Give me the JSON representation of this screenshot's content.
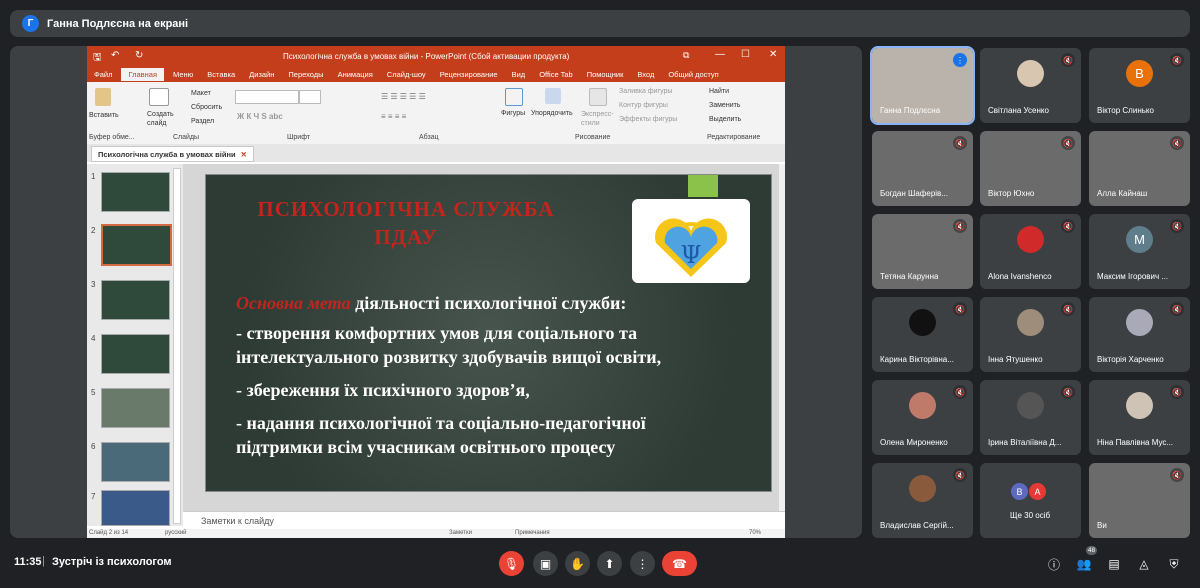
{
  "top_bar": {
    "avatar_letter": "Г",
    "title": "Ганна Подлєсна на екрані"
  },
  "powerpoint": {
    "window_title": "Психологічна служба в умовах війни - PowerPoint (Сбой активации продукта)",
    "menu": [
      "Файл",
      "Главная",
      "Меню",
      "Вставка",
      "Дизайн",
      "Переходы",
      "Анимация",
      "Слайд-шоу",
      "Рецензирование",
      "Вид",
      "Office Tab",
      "Помощник",
      "Вход",
      "Общий доступ"
    ],
    "ribbon": {
      "paste": "Вставить",
      "create_slide": "Создать слайд",
      "layout": "Макет",
      "reset": "Сбросить",
      "section": "Раздел",
      "shapes": "Фигуры",
      "arrange": "Упорядочить",
      "quick_styles": "Экспресс-стили",
      "shape_fill": "Заливка фигуры",
      "shape_outline": "Контур фигуры",
      "shape_effects": "Эффекты фигуры",
      "find": "Найти",
      "replace": "Заменить",
      "select": "Выделить",
      "groups": [
        "Буфер обме...",
        "Слайды",
        "Шрифт",
        "Абзац",
        "Рисование",
        "Редактирование"
      ]
    },
    "doc_tab": "Психологічна служба в умовах війни",
    "thumb_numbers": [
      "1",
      "2",
      "3",
      "4",
      "5",
      "6",
      "7"
    ],
    "slide": {
      "heading_line1": "ПСИХОЛОГІЧНА  СЛУЖБА",
      "heading_line2": "ПДАУ",
      "goal_prefix": "Основна мета",
      "goal_rest": " діяльності психологічної служби:",
      "line1": "- створення комфортних  умов для соціального та",
      "line2": "інтелектуального розвитку здобувачів вищої освіти,",
      "line3": "- збереження їх психічного здоров’я,",
      "line4": "- надання психологічної та соціально-педагогічної",
      "line5": "підтримки всім учасникам освітнього процесу"
    },
    "notes_placeholder": "Заметки к слайду",
    "status": {
      "slide_info": "Слайд 2 из 14",
      "language": "русский",
      "notes": "Заметки",
      "comments": "Примечания",
      "zoom": "70%"
    }
  },
  "participants": [
    {
      "name": "Ганна Подлєсна",
      "type": "video",
      "speaking": true
    },
    {
      "name": "Світлана Усенко",
      "type": "photo",
      "color": "#d8c6b0"
    },
    {
      "name": "Віктор Слинько",
      "type": "letter",
      "letter": "В",
      "color": "#e8710a"
    },
    {
      "name": "Богдан Шаферів...",
      "type": "video"
    },
    {
      "name": "Віктор Юхно",
      "type": "video"
    },
    {
      "name": "Алла Кайнаш",
      "type": "video"
    },
    {
      "name": "Тетяна Карунна",
      "type": "video"
    },
    {
      "name": "Alona Ivanshenco",
      "type": "photo",
      "color": "#d12a2a"
    },
    {
      "name": "Максим Ігорович ...",
      "type": "letter",
      "letter": "M",
      "color": "#607d8b"
    },
    {
      "name": "Карина Вікторівна...",
      "type": "photo",
      "color": "#111111"
    },
    {
      "name": "Інна Ятушенко",
      "type": "photo",
      "color": "#9e8d7a"
    },
    {
      "name": "Вікторія Харченко",
      "type": "photo",
      "color": "#a9a9b8"
    },
    {
      "name": "Олена Мироненко",
      "type": "photo",
      "color": "#c07a6a"
    },
    {
      "name": "Ірина Віталіївна Д...",
      "type": "photo",
      "color": "#555555"
    },
    {
      "name": "Ніна Павлівна Мус...",
      "type": "photo",
      "color": "#cfc3b6"
    },
    {
      "name": "Владислав Сергій...",
      "type": "photo",
      "color": "#8a5a3c"
    },
    {
      "name": "Ще 30 осіб",
      "type": "more",
      "letters": [
        "В",
        "А"
      ]
    },
    {
      "name": "Ви",
      "type": "video"
    }
  ],
  "bottom_bar": {
    "time": "11:35",
    "separator": "|",
    "meeting_name": "Зустріч із психологом",
    "people_count": "48"
  },
  "colors": {
    "accent_red": "#ea4335",
    "bg": "#202124",
    "tile": "#3c4043",
    "ppt_orange": "#c43e1c"
  }
}
